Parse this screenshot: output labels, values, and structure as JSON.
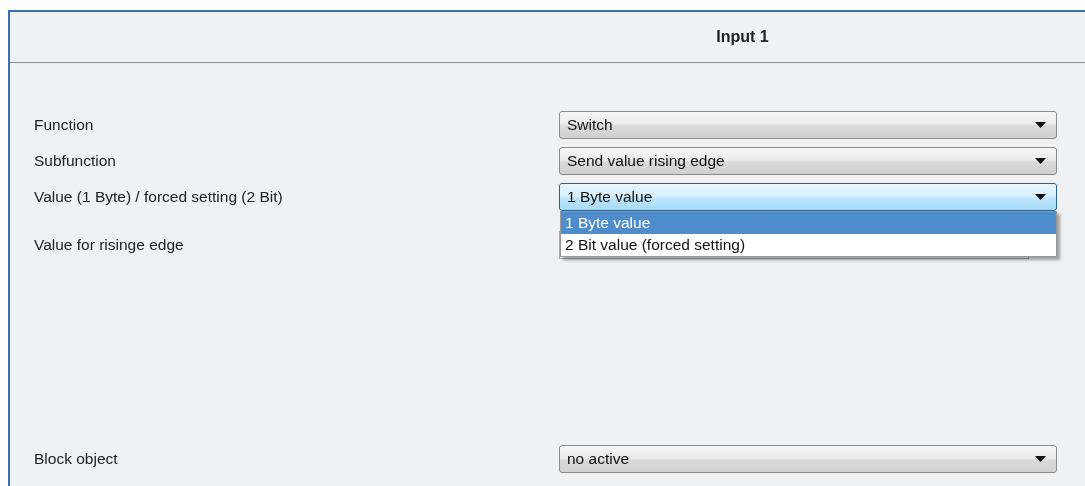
{
  "panel": {
    "title": "Input 1"
  },
  "rows": [
    {
      "kind": "dropdown",
      "label": "Function",
      "value": "Switch",
      "focused": false
    },
    {
      "kind": "dropdown",
      "label": "Subfunction",
      "value": "Send value rising edge",
      "focused": false
    },
    {
      "kind": "dropdown",
      "label": "Value (1 Byte) / forced setting (2 Bit)",
      "value": "1 Byte value",
      "focused": true,
      "options": [
        {
          "label": "1 Byte value",
          "selected": true
        },
        {
          "label": "2 Bit value (forced setting)",
          "selected": false
        }
      ]
    },
    {
      "kind": "field",
      "label": "Value for risinge edge"
    },
    {
      "kind": "gap"
    },
    {
      "kind": "dropdown",
      "label": "Block object",
      "value": "no active",
      "focused": false
    }
  ]
}
